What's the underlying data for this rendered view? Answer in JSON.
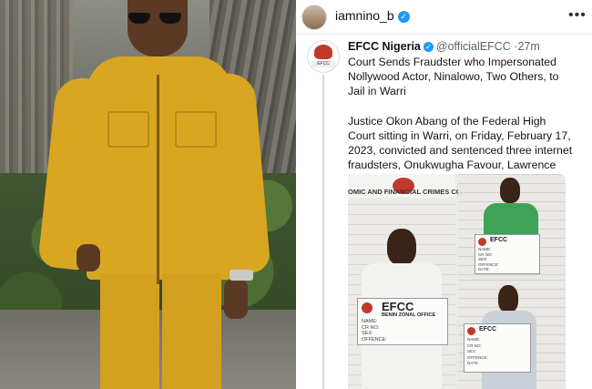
{
  "outer_post": {
    "username": "iamnino_b",
    "verified": true,
    "more_icon": "more-horizontal-icon"
  },
  "tweet": {
    "author_name": "EFCC Nigeria",
    "author_handle": "@officialEFCC",
    "separator": "·",
    "time": "27m",
    "paragraph1": "Court Sends Fraudster who Impersonated Nollywood Actor, Ninalowo, Two Others, to Jail in Warri",
    "paragraph2": "Justice Okon Abang of the Federal High Court sitting in Warri, on Friday, February 17, 2023, convicted and sentenced three internet fraudsters, Onukwugha Favour, Lawrence David..."
  },
  "mugshot": {
    "commission_text": "OMIC AND FINANCIAL CRIMES COMMIS",
    "board_large": {
      "title": "EFCC",
      "subtitle": "BENIN ZONAL OFFICE",
      "rows": [
        "NAME:",
        "CR NO:",
        "SEX:",
        "OFFENCE:"
      ]
    },
    "board_small_1": {
      "title": "EFCC",
      "rows": [
        "NAME:",
        "CR NO:",
        "SEX:",
        "OFFENCE:",
        "DATE:"
      ]
    },
    "board_small_2": {
      "title": "EFCC",
      "rows": [
        "NAME:",
        "CR NO:",
        "SEX:",
        "OFFENCE:",
        "DATE:"
      ]
    }
  },
  "colors": {
    "verified_blue": "#1d9bf0",
    "suit_mustard": "#d9a622",
    "efcc_red": "#c0392b"
  }
}
